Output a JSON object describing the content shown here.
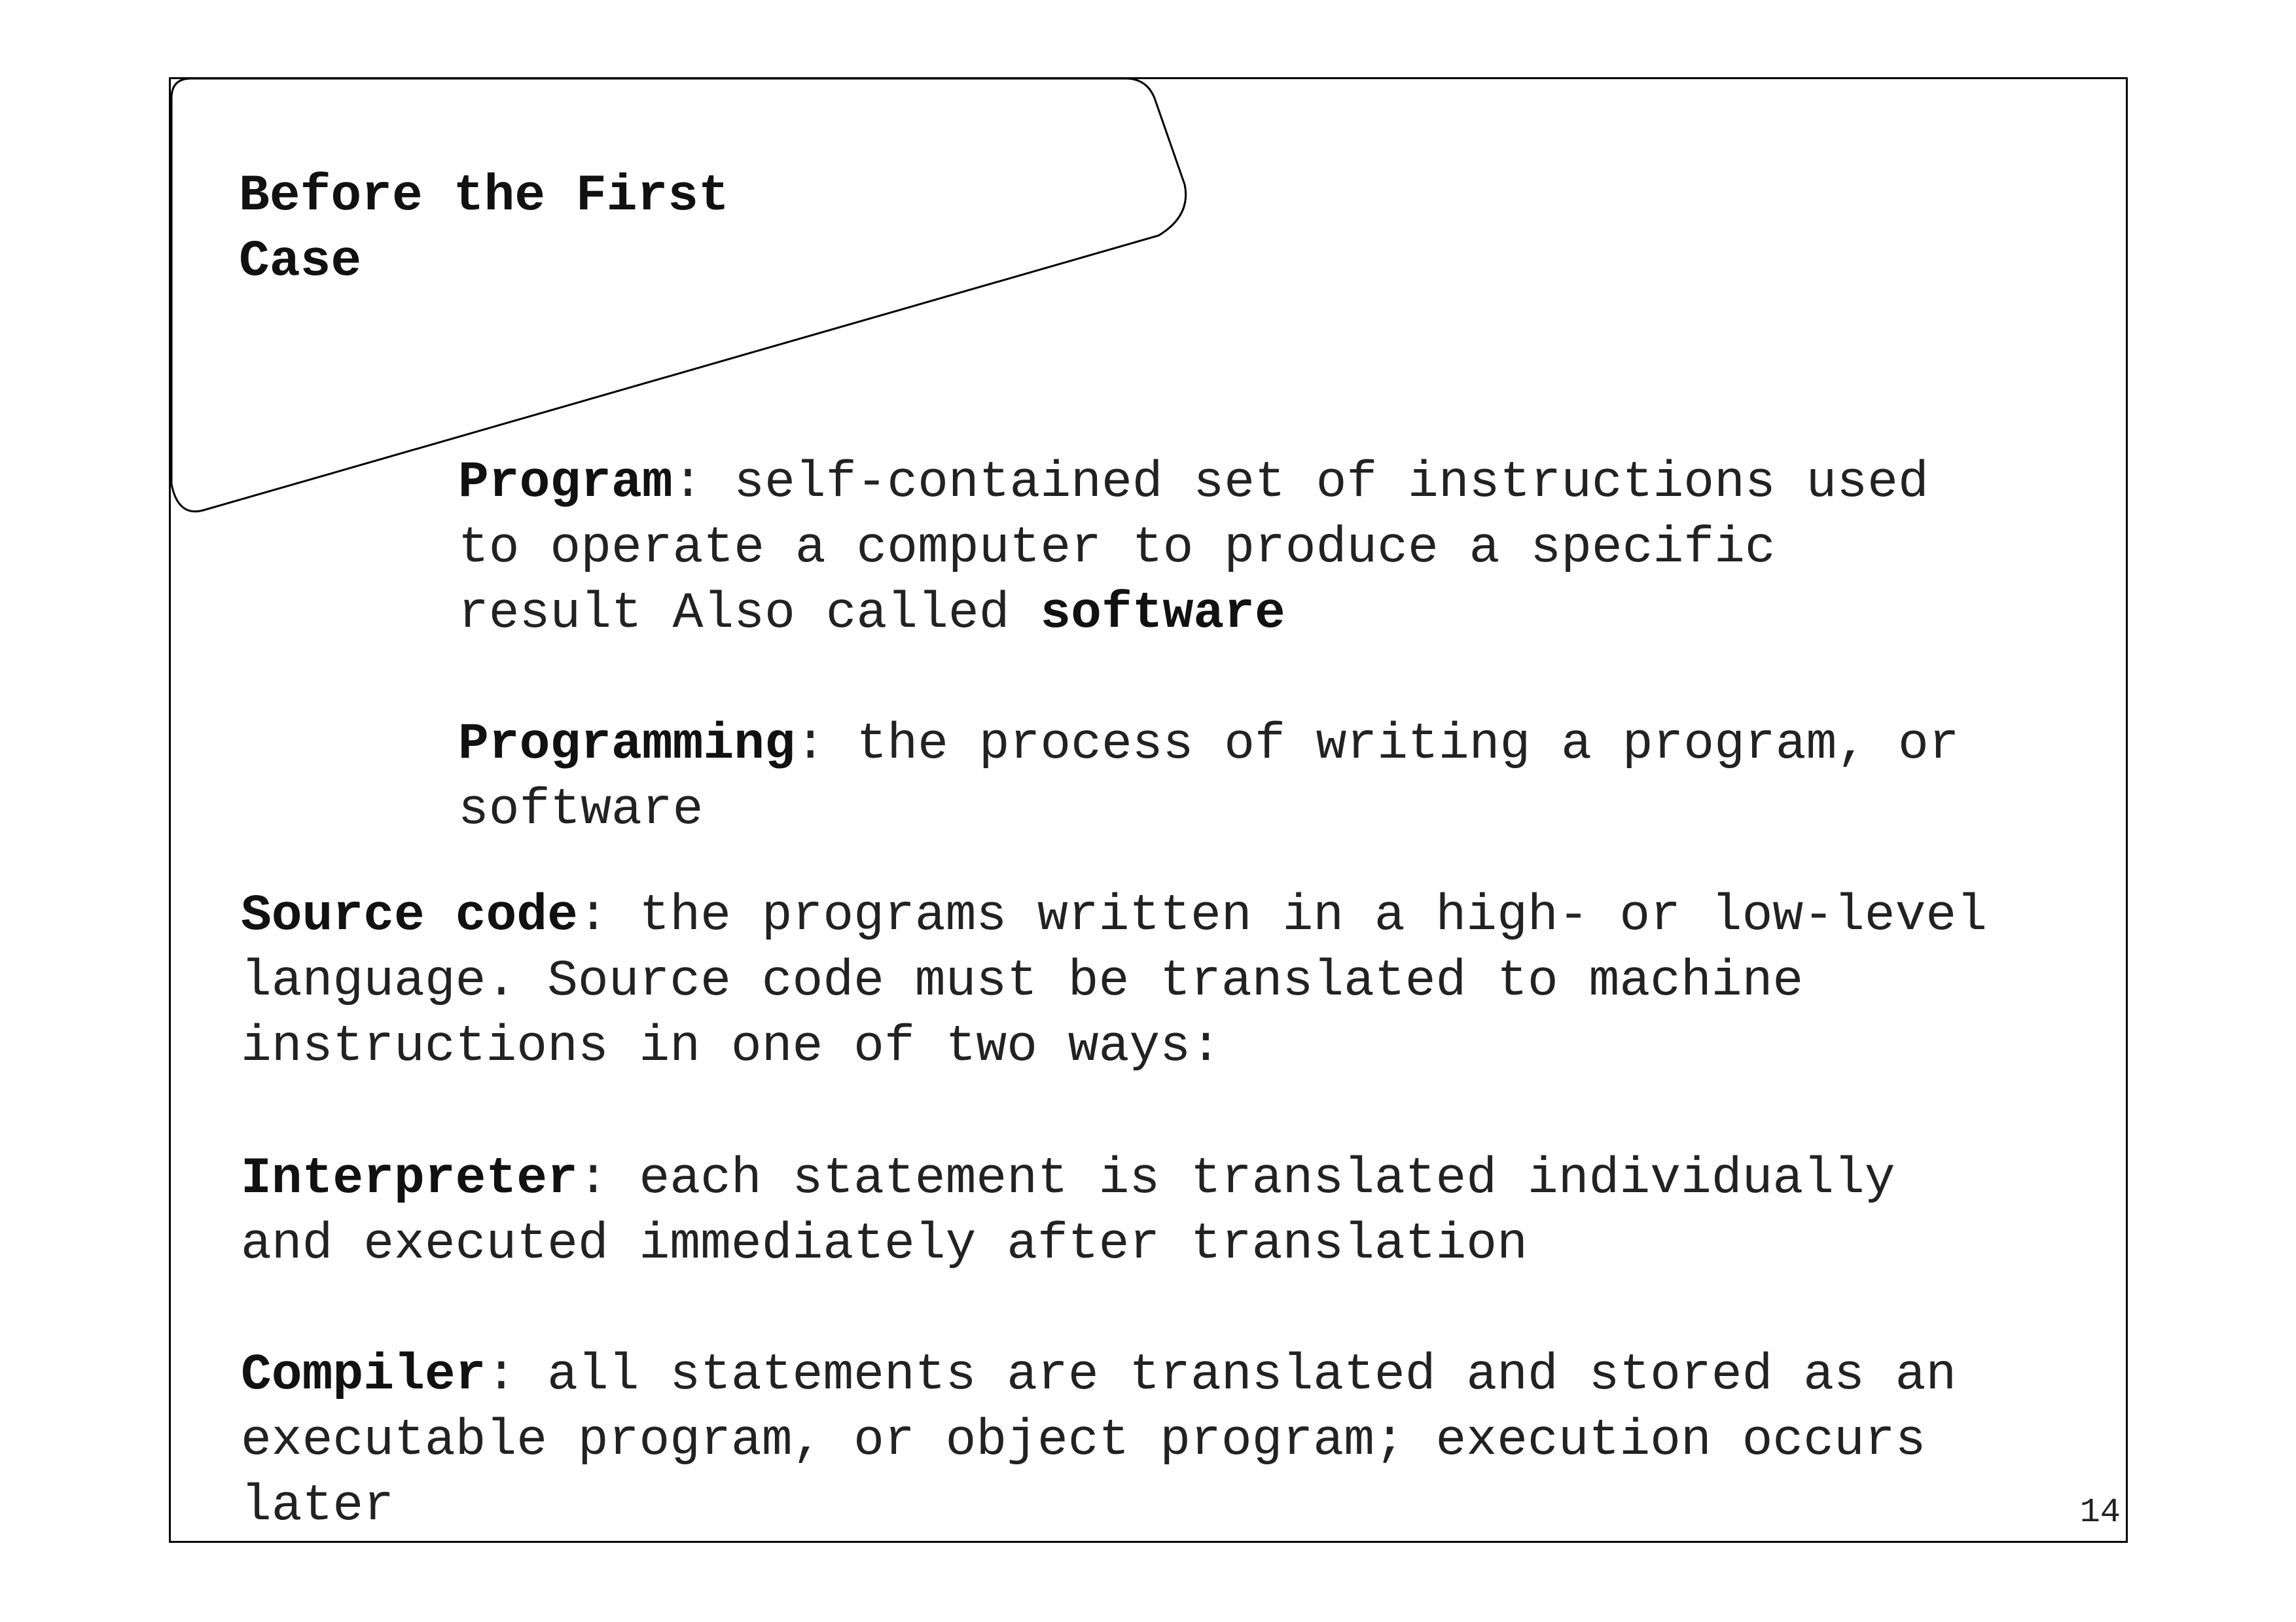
{
  "slide": {
    "title_line1": "Before the First",
    "title_line2": "Case",
    "page_number": "14"
  },
  "definitions": [
    {
      "term": "Program",
      "lines": [
        ": self-contained set of instructions used",
        "to operate a computer to produce a specific",
        "result Also called "
      ],
      "emphasis": "software"
    },
    {
      "term": "Programming",
      "lines": [
        ": the process of writing a program, or",
        "software"
      ]
    },
    {
      "term": "Source code",
      "lines": [
        ": the programs written in a high- or low-level",
        "language. Source code must be translated to machine",
        "instructions in one of two ways:"
      ]
    },
    {
      "term": "Interpreter",
      "lines": [
        ": each statement is translated individually",
        "and executed immediately after translation"
      ]
    },
    {
      "term": "Compiler",
      "lines": [
        ": all statements are translated and stored as an",
        "executable program, or object program; execution occurs",
        "later"
      ]
    }
  ]
}
